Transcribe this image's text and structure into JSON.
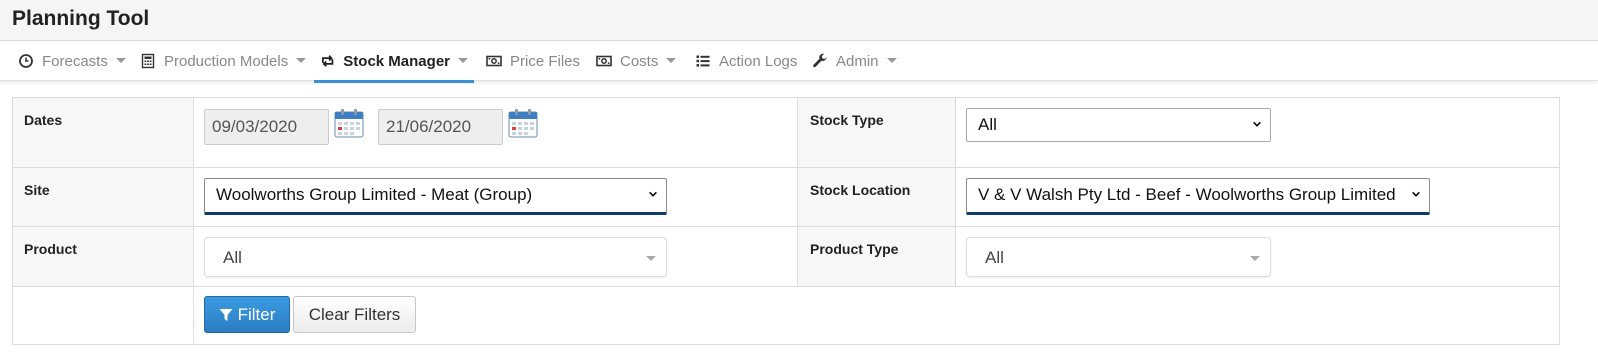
{
  "app": {
    "title": "Planning Tool"
  },
  "nav": {
    "items": [
      {
        "label": "Forecasts",
        "icon": "clock-icon",
        "dropdown": true
      },
      {
        "label": "Production Models",
        "icon": "calculator-icon",
        "dropdown": true
      },
      {
        "label": "Stock Manager",
        "icon": "retweet-icon",
        "dropdown": true,
        "active": true
      },
      {
        "label": "Price Files",
        "icon": "money-icon",
        "dropdown": false
      },
      {
        "label": "Costs",
        "icon": "money-icon",
        "dropdown": true
      },
      {
        "label": "Action Logs",
        "icon": "list-icon",
        "dropdown": false
      },
      {
        "label": "Admin",
        "icon": "wrench-icon",
        "dropdown": true
      }
    ]
  },
  "filters": {
    "dates": {
      "label": "Dates",
      "from": "09/03/2020",
      "to": "21/06/2020"
    },
    "stock_type": {
      "label": "Stock Type",
      "value": "All"
    },
    "site": {
      "label": "Site",
      "value": "Woolworths Group Limited - Meat (Group)"
    },
    "stock_location": {
      "label": "Stock Location",
      "value": "V & V Walsh Pty Ltd - Beef - Woolworths Group Limited"
    },
    "product": {
      "label": "Product",
      "value": "All"
    },
    "product_type": {
      "label": "Product Type",
      "value": "All"
    },
    "filter_button": "Filter",
    "clear_button": "Clear Filters"
  },
  "colors": {
    "accent": "#3a8fd6",
    "primary_button": "#2b7dc4",
    "focus_border": "#0d3c6e"
  }
}
